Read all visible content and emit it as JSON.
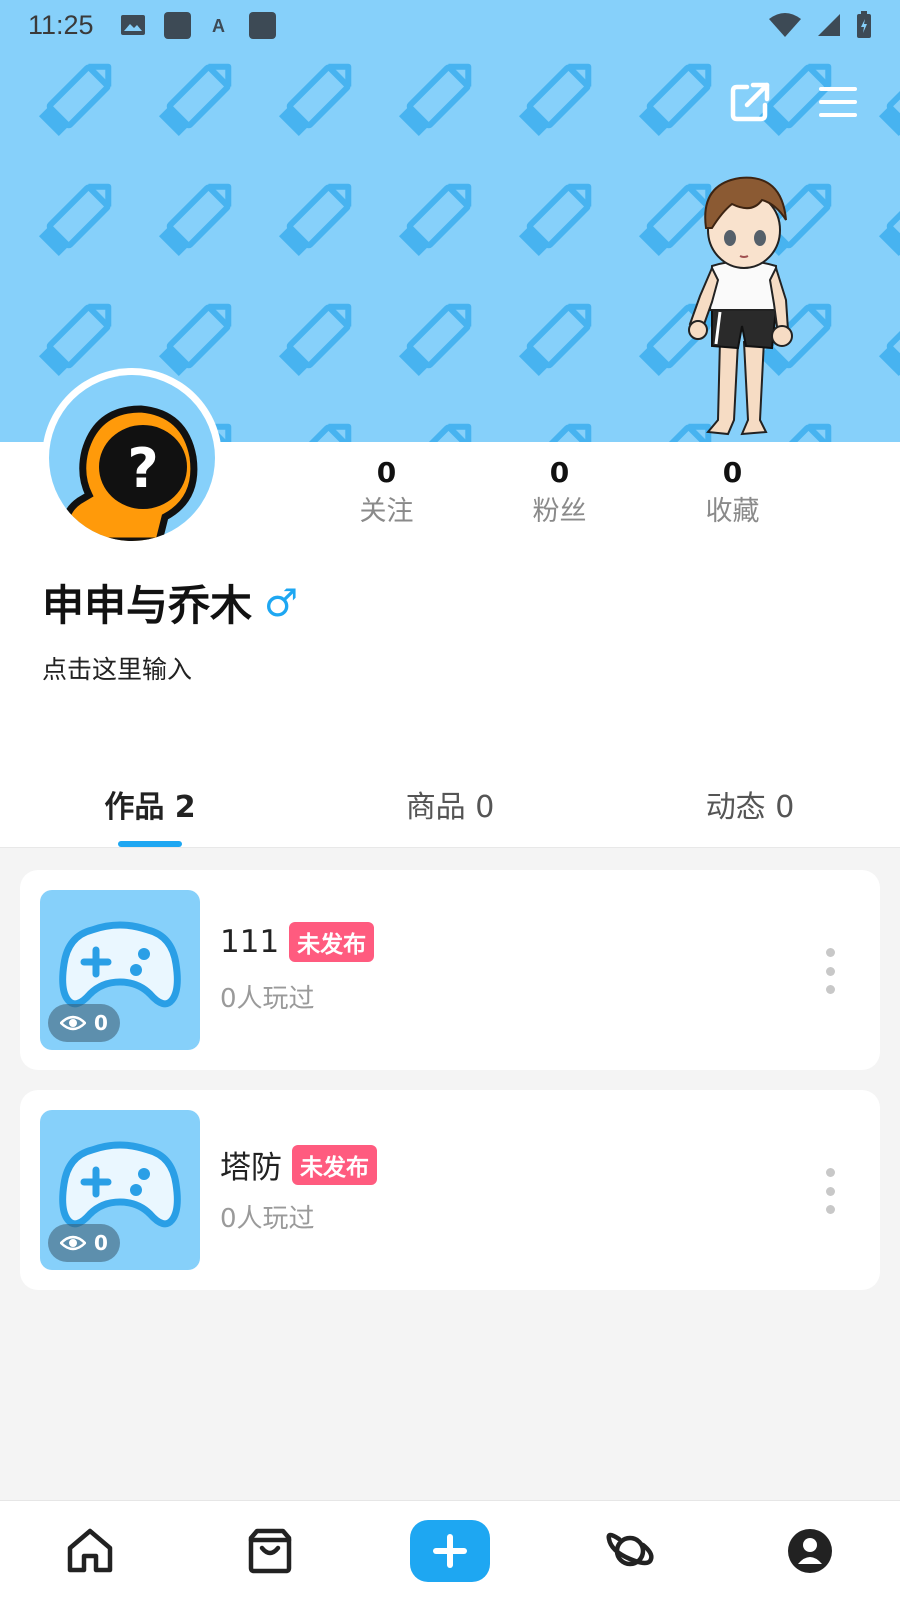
{
  "status_bar": {
    "time": "11:25"
  },
  "header": {
    "share_icon": "share-icon",
    "menu_icon": "menu-icon"
  },
  "profile": {
    "stats": [
      {
        "value": "0",
        "label": "关注"
      },
      {
        "value": "0",
        "label": "粉丝"
      },
      {
        "value": "0",
        "label": "收藏"
      }
    ],
    "username": "申申与乔木",
    "gender_symbol": "♂",
    "bio": "点击这里输入"
  },
  "tabs": [
    {
      "label": "作品 2",
      "active": true
    },
    {
      "label": "商品 0",
      "active": false
    },
    {
      "label": "动态 0",
      "active": false
    }
  ],
  "works": [
    {
      "name": "111",
      "badge": "未发布",
      "views": "0",
      "subtitle": "0人玩过"
    },
    {
      "name": "塔防",
      "badge": "未发布",
      "views": "0",
      "subtitle": "0人玩过"
    }
  ],
  "colors": {
    "accent": "#1ea7f2",
    "banner": "#86d0fa",
    "badge": "#ff5b7f",
    "avatar_orange": "#ff9a0a"
  },
  "bottom_nav": [
    "home-icon",
    "shop-bag-icon",
    "add-icon",
    "planet-icon",
    "profile-icon"
  ]
}
